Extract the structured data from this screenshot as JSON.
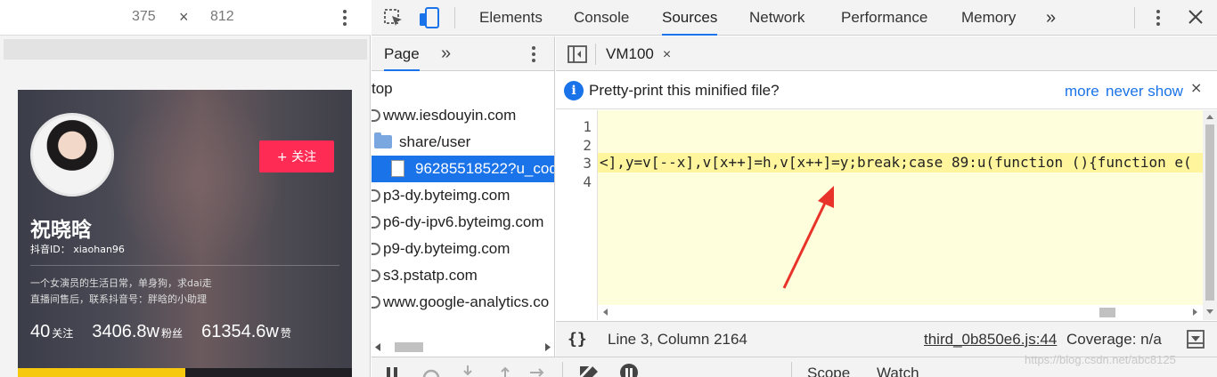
{
  "device": {
    "width": "375",
    "times": "×",
    "height": "812"
  },
  "profile": {
    "follow_label": "+ 关注",
    "nickname": "祝晓晗",
    "douyin_id": "抖音ID： xiaohan96",
    "bio_line1": "一个女演员的生活日常，单身狗，求dai走",
    "bio_line2": "直播间售后，联系抖音号：胖晗的小助理",
    "stats": [
      {
        "num": "40",
        "label": "关注"
      },
      {
        "num": "3406.8w",
        "label": "粉丝"
      },
      {
        "num": "61354.6w",
        "label": "赞"
      }
    ]
  },
  "devtools": {
    "tabs": [
      "Elements",
      "Console",
      "Sources",
      "Network",
      "Performance",
      "Memory"
    ],
    "active_tab": "Sources",
    "more": "»"
  },
  "navigator": {
    "tab": "Page",
    "more": "»",
    "items": [
      {
        "label": "top",
        "type": "frame"
      },
      {
        "label": "www.iesdouyin.com",
        "type": "domain"
      },
      {
        "label": "share/user",
        "type": "folder"
      },
      {
        "label": "96285518522?u_cod",
        "type": "file",
        "selected": true
      },
      {
        "label": "p3-dy.byteimg.com",
        "type": "domain"
      },
      {
        "label": "p6-dy-ipv6.byteimg.com",
        "type": "domain"
      },
      {
        "label": "p9-dy.byteimg.com",
        "type": "domain"
      },
      {
        "label": "s3.pstatp.com",
        "type": "domain"
      },
      {
        "label": "www.google-analytics.co",
        "type": "domain"
      }
    ]
  },
  "editor": {
    "file_tab": "VM100",
    "close": "×",
    "infobar": {
      "text": "Pretty-print this minified file?",
      "more": "more",
      "never_show": "never show",
      "close": "×"
    },
    "line_numbers": [
      "1",
      "2",
      "3",
      "4"
    ],
    "highlighted_line": "<],y=v[--x],v[x++]=h,v[x++]=y;break;case 89:u(function (){function e("
  },
  "status": {
    "braces": "{}",
    "position": "Line 3, Column 2164",
    "source": "third_0b850e6.js:44",
    "coverage": "Coverage: n/a"
  },
  "bottom": {
    "scope": "Scope",
    "watch": "Watch"
  },
  "watermark": "https://blog.csdn.net/abc8125",
  "colors": {
    "accent": "#1a73e8",
    "follow_button": "#fe2c55",
    "highlight_line": "#fff59d",
    "annotation_arrow": "#e8332a"
  },
  "icons": [
    "inspect-icon",
    "device-toggle-icon",
    "more-tabs-icon",
    "kebab-menu-icon",
    "close-icon",
    "sidebar-toggle-icon",
    "info-icon",
    "pause-icon",
    "breakpoint-icon",
    "step-icon"
  ]
}
